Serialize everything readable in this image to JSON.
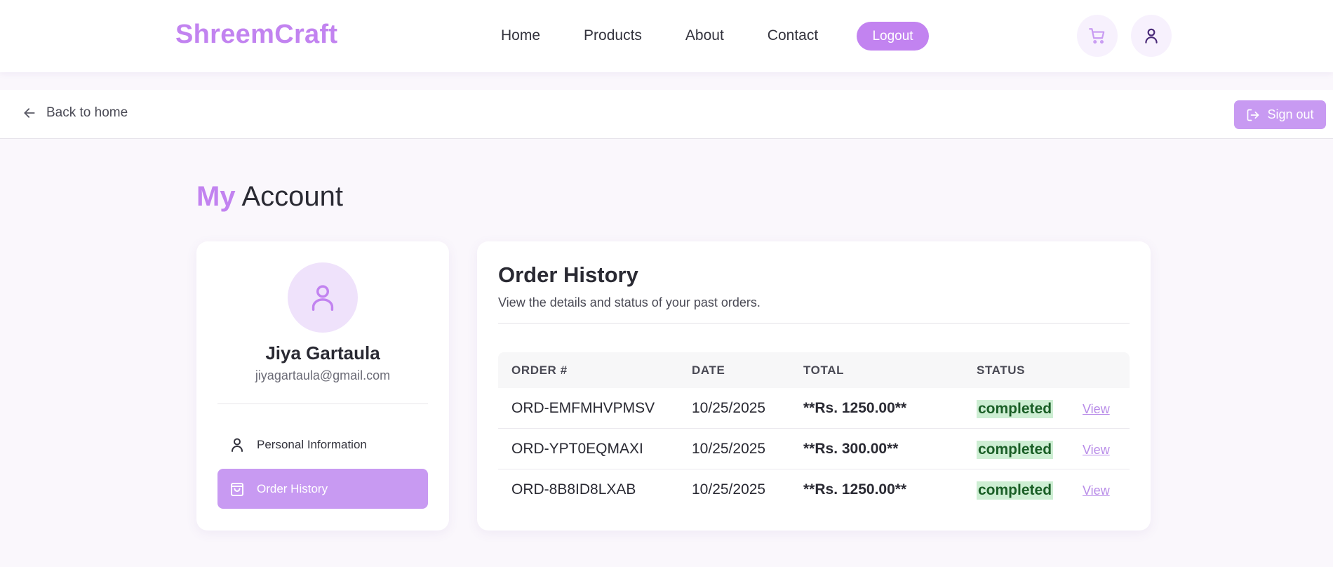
{
  "header": {
    "logo": "ShreemCraft",
    "nav": [
      "Home",
      "Products",
      "About",
      "Contact"
    ],
    "logout_label": "Logout",
    "icons": [
      "cart-icon",
      "user-icon"
    ]
  },
  "subbar": {
    "back_label": "Back to home",
    "signout_label": "Sign out"
  },
  "page": {
    "title_accent": "My",
    "title_rest": "Account"
  },
  "profile": {
    "name": "Jiya Gartaula",
    "email": "jiyagartaula@gmail.com",
    "menu": [
      {
        "label": "Personal Information",
        "icon": "user-icon",
        "active": false
      },
      {
        "label": "Order History",
        "icon": "shopping-bag-icon",
        "active": true
      }
    ]
  },
  "orders": {
    "title": "Order History",
    "subtitle": "View the details and status of your past orders.",
    "columns": [
      "ORDER #",
      "DATE",
      "TOTAL",
      "STATUS"
    ],
    "rows": [
      {
        "id": "ORD-EMFMHVPMSV",
        "date": "10/25/2025",
        "total": "**Rs. 1250.00**",
        "status": "completed",
        "action": "View"
      },
      {
        "id": "ORD-YPT0EQMAXI",
        "date": "10/25/2025",
        "total": "**Rs. 300.00**",
        "status": "completed",
        "action": "View"
      },
      {
        "id": "ORD-8B8ID8LXAB",
        "date": "10/25/2025",
        "total": "**Rs. 1250.00**",
        "status": "completed",
        "action": "View"
      }
    ]
  },
  "colors": {
    "accent": "#c283f0",
    "accent_light": "#c89af2",
    "status_bg": "#cdeed3",
    "status_text": "#1a5e26"
  }
}
